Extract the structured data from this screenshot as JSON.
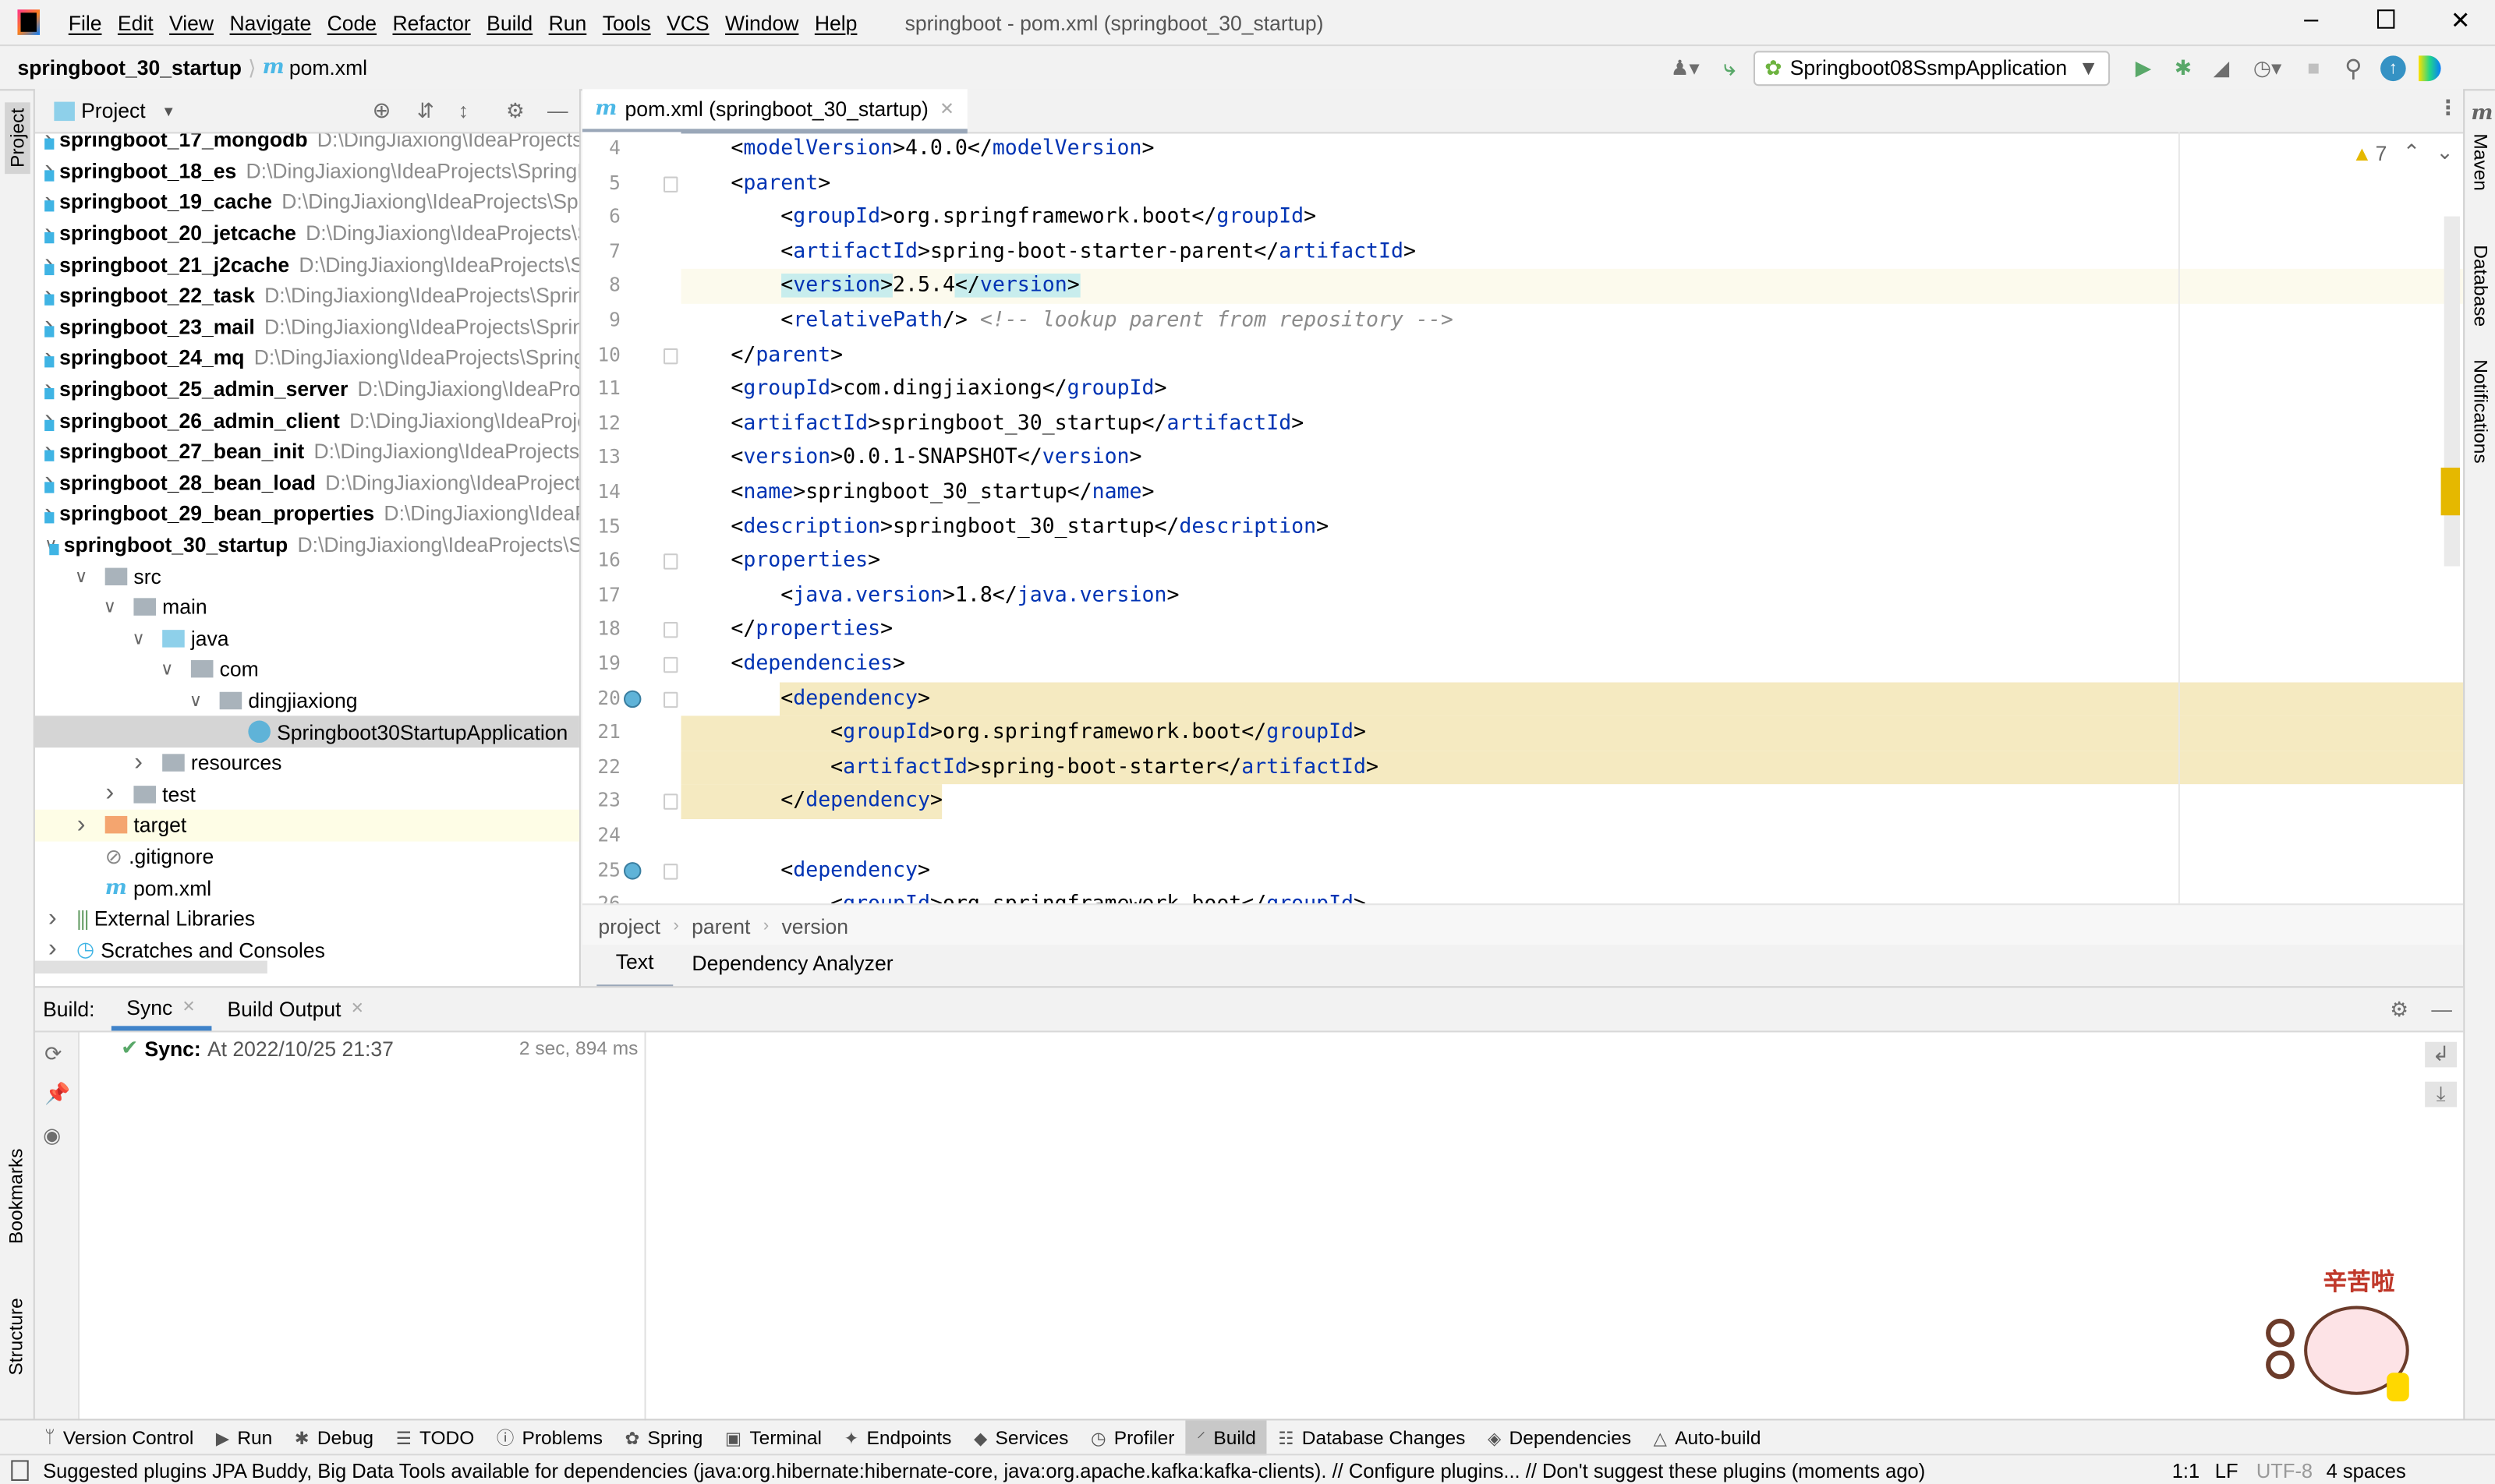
{
  "app": {
    "menu": [
      "File",
      "Edit",
      "View",
      "Navigate",
      "Code",
      "Refactor",
      "Build",
      "Run",
      "Tools",
      "VCS",
      "Window",
      "Help"
    ],
    "title": "springboot - pom.xml (springboot_30_startup)"
  },
  "nav": {
    "project": "springboot_30_startup",
    "file": "pom.xml",
    "run_config": "Springboot08SsmpApplication"
  },
  "left_strip": {
    "project": "Project",
    "bookmarks": "Bookmarks",
    "structure": "Structure"
  },
  "right_strip": {
    "maven": "Maven",
    "database": "Database",
    "notifications": "Notifications"
  },
  "project_panel": {
    "title": "Project",
    "modules": [
      {
        "name": "springboot_17_mongodb",
        "path": "D:\\DingJiaxiong\\IdeaProjects\\SpringBootStudyHeiMa"
      },
      {
        "name": "springboot_18_es",
        "path": "D:\\DingJiaxiong\\IdeaProjects\\SpringBootStudyHeiMa"
      },
      {
        "name": "springboot_19_cache",
        "path": "D:\\DingJiaxiong\\IdeaProjects\\SpringBootStudyHeiMa"
      },
      {
        "name": "springboot_20_jetcache",
        "path": "D:\\DingJiaxiong\\IdeaProjects\\SpringBootStudyHeiMa"
      },
      {
        "name": "springboot_21_j2cache",
        "path": "D:\\DingJiaxiong\\IdeaProjects\\SpringBootStudyHeiMa"
      },
      {
        "name": "springboot_22_task",
        "path": "D:\\DingJiaxiong\\IdeaProjects\\SpringBootStudyHeiMa"
      },
      {
        "name": "springboot_23_mail",
        "path": "D:\\DingJiaxiong\\IdeaProjects\\SpringBootStudyHeiMa"
      },
      {
        "name": "springboot_24_mq",
        "path": "D:\\DingJiaxiong\\IdeaProjects\\SpringBootStudyHeiMa"
      },
      {
        "name": "springboot_25_admin_server",
        "path": "D:\\DingJiaxiong\\IdeaProjects\\SpringBootStudyHeiMa"
      },
      {
        "name": "springboot_26_admin_client",
        "path": "D:\\DingJiaxiong\\IdeaProjects\\SpringBootStudyHeiMa"
      },
      {
        "name": "springboot_27_bean_init",
        "path": "D:\\DingJiaxiong\\IdeaProjects\\SpringBootStudyHeiMa"
      },
      {
        "name": "springboot_28_bean_load",
        "path": "D:\\DingJiaxiong\\IdeaProjects\\SpringBootStudyHeiMa"
      },
      {
        "name": "springboot_29_bean_properties",
        "path": "D:\\DingJiaxiong\\IdeaProjects\\SpringBootStudyHeiMa"
      },
      {
        "name": "springboot_30_startup",
        "path": "D:\\DingJiaxiong\\IdeaProjects\\SpringBootStudyHeiMa"
      }
    ],
    "children": [
      {
        "label": "src",
        "level": 1,
        "chev": "open",
        "icon": "folder"
      },
      {
        "label": "main",
        "level": 2,
        "chev": "open",
        "icon": "folder"
      },
      {
        "label": "java",
        "level": 3,
        "chev": "open",
        "icon": "folder-blue"
      },
      {
        "label": "com",
        "level": 4,
        "chev": "open",
        "icon": "package"
      },
      {
        "label": "dingjiaxiong",
        "level": 5,
        "chev": "open",
        "icon": "package"
      },
      {
        "label": "Springboot30StartupApplication",
        "level": 6,
        "chev": "none",
        "icon": "spring-class",
        "selected": true
      },
      {
        "label": "resources",
        "level": 3,
        "chev": "closed",
        "icon": "folder-resources"
      },
      {
        "label": "test",
        "level": 2,
        "chev": "closed",
        "icon": "folder"
      },
      {
        "label": "target",
        "level": 1,
        "chev": "closed",
        "icon": "folder-orange",
        "highlight": true
      },
      {
        "label": ".gitignore",
        "level": 1,
        "chev": "none",
        "icon": "ignore-file"
      },
      {
        "label": "pom.xml",
        "level": 1,
        "chev": "none",
        "icon": "maven"
      },
      {
        "label": "External Libraries",
        "level": 0,
        "chev": "closed",
        "icon": "libraries"
      },
      {
        "label": "Scratches and Consoles",
        "level": 0,
        "chev": "closed",
        "icon": "scratches"
      }
    ]
  },
  "editor": {
    "tab": "pom.xml (springboot_30_startup)",
    "warnings": "7",
    "lines": [
      {
        "n": "4",
        "text": "    <modelVersion>4.0.0</modelVersion>"
      },
      {
        "n": "5",
        "text": "    <parent>"
      },
      {
        "n": "6",
        "text": "        <groupId>org.springframework.boot</groupId>"
      },
      {
        "n": "7",
        "text": "        <artifactId>spring-boot-starter-parent</artifactId>"
      },
      {
        "n": "8",
        "text": "        <version>2.5.4</version>",
        "current": true
      },
      {
        "n": "9",
        "text": "        <relativePath/> <!-- lookup parent from repository -->"
      },
      {
        "n": "10",
        "text": "    </parent>"
      },
      {
        "n": "11",
        "text": "    <groupId>com.dingjiaxiong</groupId>"
      },
      {
        "n": "12",
        "text": "    <artifactId>springboot_30_startup</artifactId>"
      },
      {
        "n": "13",
        "text": "    <version>0.0.1-SNAPSHOT</version>"
      },
      {
        "n": "14",
        "text": "    <name>springboot_30_startup</name>"
      },
      {
        "n": "15",
        "text": "    <description>springboot_30_startup</description>"
      },
      {
        "n": "16",
        "text": "    <properties>"
      },
      {
        "n": "17",
        "text": "        <java.version>1.8</java.version>"
      },
      {
        "n": "18",
        "text": "    </properties>"
      },
      {
        "n": "19",
        "text": "    <dependencies>"
      },
      {
        "n": "20",
        "text": "        <dependency>",
        "marker": true,
        "hl": true
      },
      {
        "n": "21",
        "text": "            <groupId>org.springframework.boot</groupId>",
        "hl": true
      },
      {
        "n": "22",
        "text": "            <artifactId>spring-boot-starter</artifactId>",
        "hl": true
      },
      {
        "n": "23",
        "text": "        </dependency>",
        "hl": true
      },
      {
        "n": "24",
        "text": ""
      },
      {
        "n": "25",
        "text": "        <dependency>",
        "marker": true
      },
      {
        "n": "26",
        "text": "            <groupId>org.springframework.boot</groupId>"
      }
    ],
    "breadcrumb": [
      "project",
      "parent",
      "version"
    ],
    "subtabs": [
      "Text",
      "Dependency Analyzer"
    ]
  },
  "build": {
    "label": "Build:",
    "tabs": [
      "Sync",
      "Build Output"
    ],
    "sync_label": "Sync:",
    "sync_text": "At 2022/10/25 21:37",
    "duration": "2 sec, 894 ms"
  },
  "sticker": {
    "text": "辛苦啦"
  },
  "toolwindows": [
    {
      "label": "Version Control",
      "icon": "branch-icon"
    },
    {
      "label": "Run",
      "icon": "play-icon"
    },
    {
      "label": "Debug",
      "icon": "bug-icon"
    },
    {
      "label": "TODO",
      "icon": "list-icon"
    },
    {
      "label": "Problems",
      "icon": "problems-icon"
    },
    {
      "label": "Spring",
      "icon": "spring-icon"
    },
    {
      "label": "Terminal",
      "icon": "terminal-icon"
    },
    {
      "label": "Endpoints",
      "icon": "endpoints-icon"
    },
    {
      "label": "Services",
      "icon": "services-icon"
    },
    {
      "label": "Profiler",
      "icon": "profiler-icon"
    },
    {
      "label": "Build",
      "icon": "hammer-icon",
      "selected": true
    },
    {
      "label": "Database Changes",
      "icon": "database-icon"
    },
    {
      "label": "Dependencies",
      "icon": "dependencies-icon"
    },
    {
      "label": "Auto-build",
      "icon": "autobuild-icon"
    }
  ],
  "status": {
    "message": "Suggested plugins JPA Buddy, Big Data Tools available for dependencies (java:org.hibernate:hibernate-core, java:org.apache.kafka:kafka-clients). // Configure plugins... // Don't suggest these plugins (moments ago)",
    "position": "1:1",
    "line_sep": "LF",
    "encoding": "UTF-8",
    "indent": "4 spaces"
  },
  "colors": {
    "tag": "#0033b3",
    "comment": "#8c8c8c",
    "accent": "#3592c4",
    "dep_highlight": "#f5eac1",
    "current_line": "#fcfaed",
    "run_green": "#59a869",
    "warning": "#e5b800"
  }
}
